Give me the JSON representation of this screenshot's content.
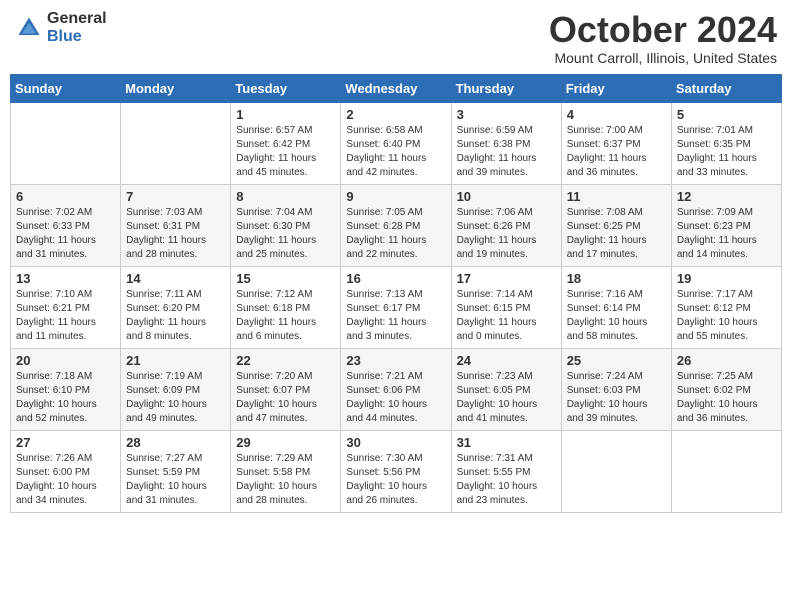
{
  "logo": {
    "general": "General",
    "blue": "Blue"
  },
  "title": "October 2024",
  "location": "Mount Carroll, Illinois, United States",
  "days_of_week": [
    "Sunday",
    "Monday",
    "Tuesday",
    "Wednesday",
    "Thursday",
    "Friday",
    "Saturday"
  ],
  "weeks": [
    [
      {
        "day": "",
        "info": ""
      },
      {
        "day": "",
        "info": ""
      },
      {
        "day": "1",
        "info": "Sunrise: 6:57 AM\nSunset: 6:42 PM\nDaylight: 11 hours and 45 minutes."
      },
      {
        "day": "2",
        "info": "Sunrise: 6:58 AM\nSunset: 6:40 PM\nDaylight: 11 hours and 42 minutes."
      },
      {
        "day": "3",
        "info": "Sunrise: 6:59 AM\nSunset: 6:38 PM\nDaylight: 11 hours and 39 minutes."
      },
      {
        "day": "4",
        "info": "Sunrise: 7:00 AM\nSunset: 6:37 PM\nDaylight: 11 hours and 36 minutes."
      },
      {
        "day": "5",
        "info": "Sunrise: 7:01 AM\nSunset: 6:35 PM\nDaylight: 11 hours and 33 minutes."
      }
    ],
    [
      {
        "day": "6",
        "info": "Sunrise: 7:02 AM\nSunset: 6:33 PM\nDaylight: 11 hours and 31 minutes."
      },
      {
        "day": "7",
        "info": "Sunrise: 7:03 AM\nSunset: 6:31 PM\nDaylight: 11 hours and 28 minutes."
      },
      {
        "day": "8",
        "info": "Sunrise: 7:04 AM\nSunset: 6:30 PM\nDaylight: 11 hours and 25 minutes."
      },
      {
        "day": "9",
        "info": "Sunrise: 7:05 AM\nSunset: 6:28 PM\nDaylight: 11 hours and 22 minutes."
      },
      {
        "day": "10",
        "info": "Sunrise: 7:06 AM\nSunset: 6:26 PM\nDaylight: 11 hours and 19 minutes."
      },
      {
        "day": "11",
        "info": "Sunrise: 7:08 AM\nSunset: 6:25 PM\nDaylight: 11 hours and 17 minutes."
      },
      {
        "day": "12",
        "info": "Sunrise: 7:09 AM\nSunset: 6:23 PM\nDaylight: 11 hours and 14 minutes."
      }
    ],
    [
      {
        "day": "13",
        "info": "Sunrise: 7:10 AM\nSunset: 6:21 PM\nDaylight: 11 hours and 11 minutes."
      },
      {
        "day": "14",
        "info": "Sunrise: 7:11 AM\nSunset: 6:20 PM\nDaylight: 11 hours and 8 minutes."
      },
      {
        "day": "15",
        "info": "Sunrise: 7:12 AM\nSunset: 6:18 PM\nDaylight: 11 hours and 6 minutes."
      },
      {
        "day": "16",
        "info": "Sunrise: 7:13 AM\nSunset: 6:17 PM\nDaylight: 11 hours and 3 minutes."
      },
      {
        "day": "17",
        "info": "Sunrise: 7:14 AM\nSunset: 6:15 PM\nDaylight: 11 hours and 0 minutes."
      },
      {
        "day": "18",
        "info": "Sunrise: 7:16 AM\nSunset: 6:14 PM\nDaylight: 10 hours and 58 minutes."
      },
      {
        "day": "19",
        "info": "Sunrise: 7:17 AM\nSunset: 6:12 PM\nDaylight: 10 hours and 55 minutes."
      }
    ],
    [
      {
        "day": "20",
        "info": "Sunrise: 7:18 AM\nSunset: 6:10 PM\nDaylight: 10 hours and 52 minutes."
      },
      {
        "day": "21",
        "info": "Sunrise: 7:19 AM\nSunset: 6:09 PM\nDaylight: 10 hours and 49 minutes."
      },
      {
        "day": "22",
        "info": "Sunrise: 7:20 AM\nSunset: 6:07 PM\nDaylight: 10 hours and 47 minutes."
      },
      {
        "day": "23",
        "info": "Sunrise: 7:21 AM\nSunset: 6:06 PM\nDaylight: 10 hours and 44 minutes."
      },
      {
        "day": "24",
        "info": "Sunrise: 7:23 AM\nSunset: 6:05 PM\nDaylight: 10 hours and 41 minutes."
      },
      {
        "day": "25",
        "info": "Sunrise: 7:24 AM\nSunset: 6:03 PM\nDaylight: 10 hours and 39 minutes."
      },
      {
        "day": "26",
        "info": "Sunrise: 7:25 AM\nSunset: 6:02 PM\nDaylight: 10 hours and 36 minutes."
      }
    ],
    [
      {
        "day": "27",
        "info": "Sunrise: 7:26 AM\nSunset: 6:00 PM\nDaylight: 10 hours and 34 minutes."
      },
      {
        "day": "28",
        "info": "Sunrise: 7:27 AM\nSunset: 5:59 PM\nDaylight: 10 hours and 31 minutes."
      },
      {
        "day": "29",
        "info": "Sunrise: 7:29 AM\nSunset: 5:58 PM\nDaylight: 10 hours and 28 minutes."
      },
      {
        "day": "30",
        "info": "Sunrise: 7:30 AM\nSunset: 5:56 PM\nDaylight: 10 hours and 26 minutes."
      },
      {
        "day": "31",
        "info": "Sunrise: 7:31 AM\nSunset: 5:55 PM\nDaylight: 10 hours and 23 minutes."
      },
      {
        "day": "",
        "info": ""
      },
      {
        "day": "",
        "info": ""
      }
    ]
  ]
}
